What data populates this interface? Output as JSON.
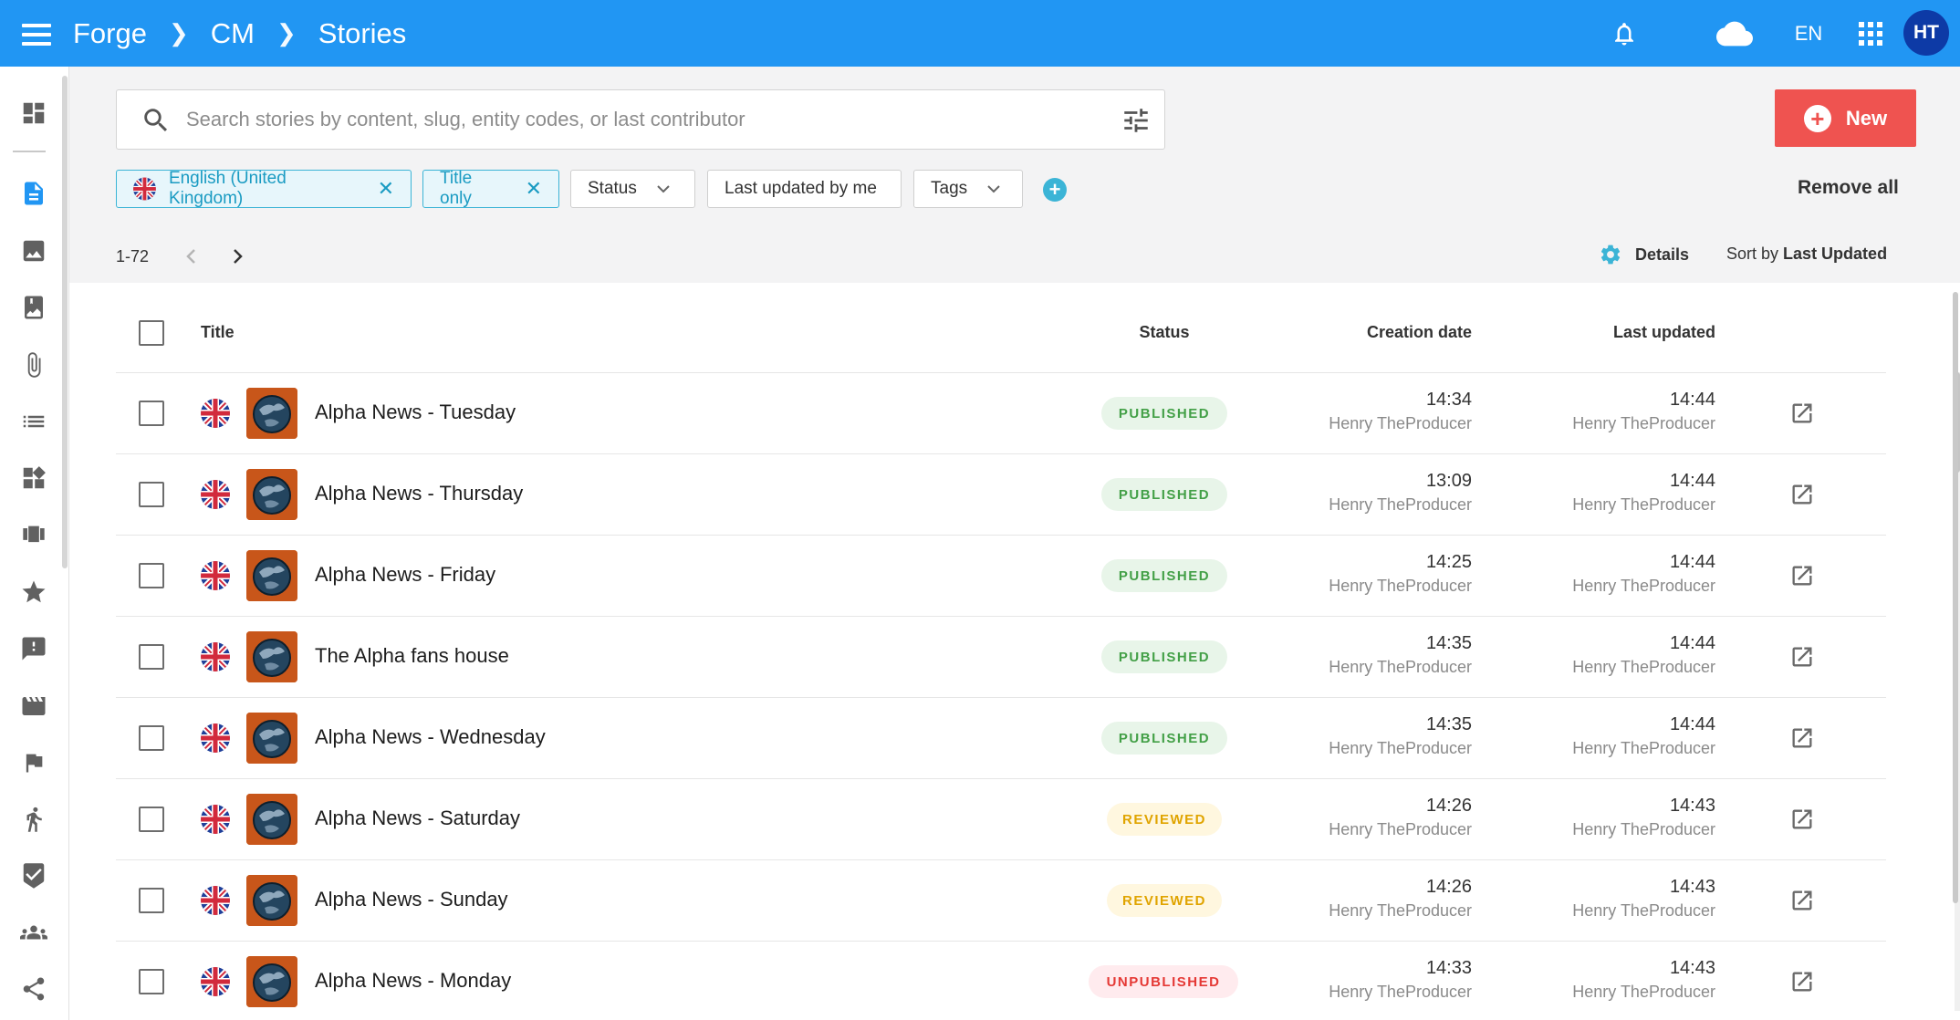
{
  "app": {
    "breadcrumbs": [
      "Forge",
      "CM",
      "Stories"
    ],
    "language": "EN",
    "user_initials": "HT"
  },
  "search": {
    "placeholder": "Search stories by content, slug, entity codes, or last contributor",
    "value": ""
  },
  "new_button": {
    "label": "New"
  },
  "filters": {
    "active": [
      {
        "label": "English (United Kingdom)",
        "icon": "uk-flag-icon"
      },
      {
        "label": "Title only"
      }
    ],
    "dropdowns": [
      "Status",
      "Last updated by me",
      "Tags"
    ],
    "remove_all": "Remove all"
  },
  "pagination": {
    "range": "1-72"
  },
  "toolbar": {
    "details_label": "Details",
    "sort_prefix": "Sort by",
    "sort_value": "Last Updated"
  },
  "table": {
    "columns": [
      "Title",
      "Status",
      "Creation date",
      "Last updated"
    ],
    "rows": [
      {
        "title": "Alpha News - Tuesday",
        "status": "PUBLISHED",
        "created": "14:34",
        "created_by": "Henry TheProducer",
        "updated": "14:44",
        "updated_by": "Henry TheProducer"
      },
      {
        "title": "Alpha News - Thursday",
        "status": "PUBLISHED",
        "created": "13:09",
        "created_by": "Henry TheProducer",
        "updated": "14:44",
        "updated_by": "Henry TheProducer"
      },
      {
        "title": "Alpha News - Friday",
        "status": "PUBLISHED",
        "created": "14:25",
        "created_by": "Henry TheProducer",
        "updated": "14:44",
        "updated_by": "Henry TheProducer"
      },
      {
        "title": "The Alpha fans house",
        "status": "PUBLISHED",
        "created": "14:35",
        "created_by": "Henry TheProducer",
        "updated": "14:44",
        "updated_by": "Henry TheProducer"
      },
      {
        "title": "Alpha News - Wednesday",
        "status": "PUBLISHED",
        "created": "14:35",
        "created_by": "Henry TheProducer",
        "updated": "14:44",
        "updated_by": "Henry TheProducer"
      },
      {
        "title": "Alpha News - Saturday",
        "status": "REVIEWED",
        "created": "14:26",
        "created_by": "Henry TheProducer",
        "updated": "14:43",
        "updated_by": "Henry TheProducer"
      },
      {
        "title": "Alpha News - Sunday",
        "status": "REVIEWED",
        "created": "14:26",
        "created_by": "Henry TheProducer",
        "updated": "14:43",
        "updated_by": "Henry TheProducer"
      },
      {
        "title": "Alpha News - Monday",
        "status": "UNPUBLISHED",
        "created": "14:33",
        "created_by": "Henry TheProducer",
        "updated": "14:43",
        "updated_by": "Henry TheProducer"
      }
    ]
  },
  "colors": {
    "topbar": "#2196f3",
    "accent": "#3bb4d6",
    "new_button": "#ef5350",
    "published": "#43a047",
    "reviewed": "#e0a400",
    "unpublished": "#e53935"
  },
  "nav_icons": [
    "dashboard-icon",
    "stories-icon",
    "images-icon",
    "bookmark-icon",
    "attachment-icon",
    "list-icon",
    "widgets-icon",
    "carousel-icon",
    "star-icon",
    "feedback-icon",
    "video-icon",
    "flag-icon",
    "sports-icon",
    "verified-icon",
    "people-icon",
    "share-icon"
  ]
}
